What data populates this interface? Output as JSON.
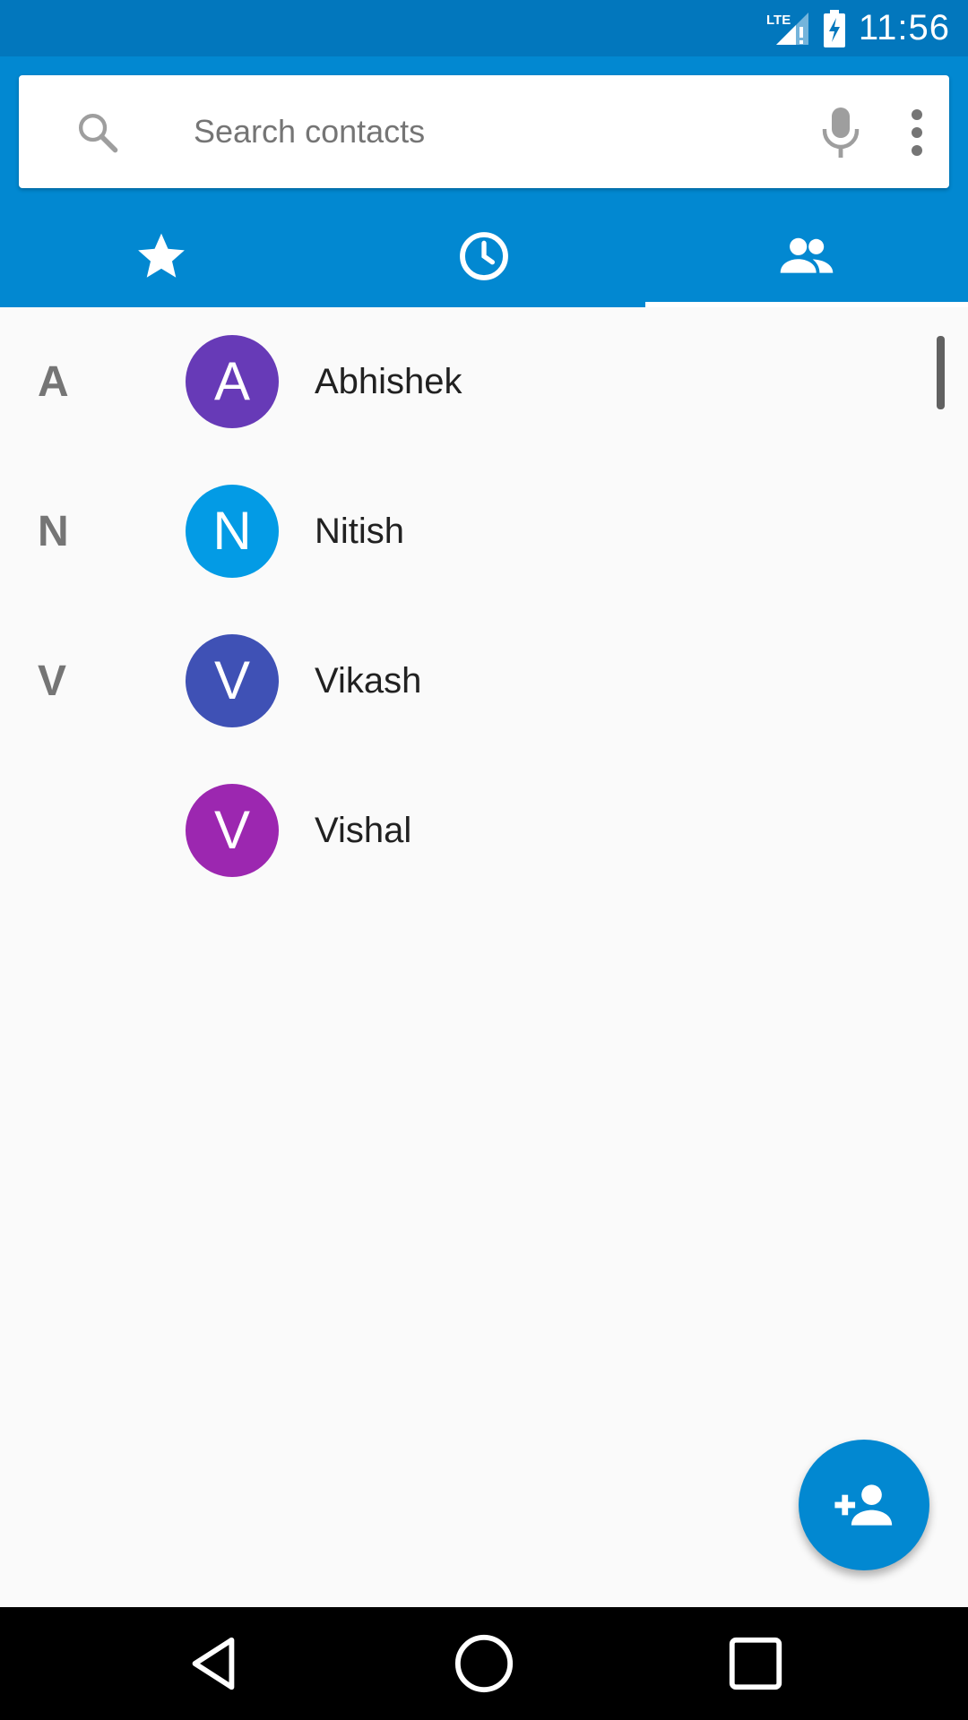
{
  "status_bar": {
    "network_label": "LTE",
    "time": "11:56"
  },
  "search": {
    "placeholder": "Search contacts"
  },
  "tabs": [
    {
      "icon": "star-icon",
      "active": false
    },
    {
      "icon": "clock-icon",
      "active": false
    },
    {
      "icon": "people-icon",
      "active": true
    }
  ],
  "contacts": [
    {
      "section": "A",
      "initial": "A",
      "name": "Abhishek",
      "color": "#673ab7"
    },
    {
      "section": "N",
      "initial": "N",
      "name": "Nitish",
      "color": "#039be5"
    },
    {
      "section": "V",
      "initial": "V",
      "name": "Vikash",
      "color": "#3f51b5"
    },
    {
      "section": "",
      "initial": "V",
      "name": "Vishal",
      "color": "#9c27b0"
    }
  ],
  "colors": {
    "status_bar": "#0277bd",
    "header": "#0288d1",
    "fab": "#0288d1"
  },
  "fab": {
    "icon": "add-person-icon"
  }
}
